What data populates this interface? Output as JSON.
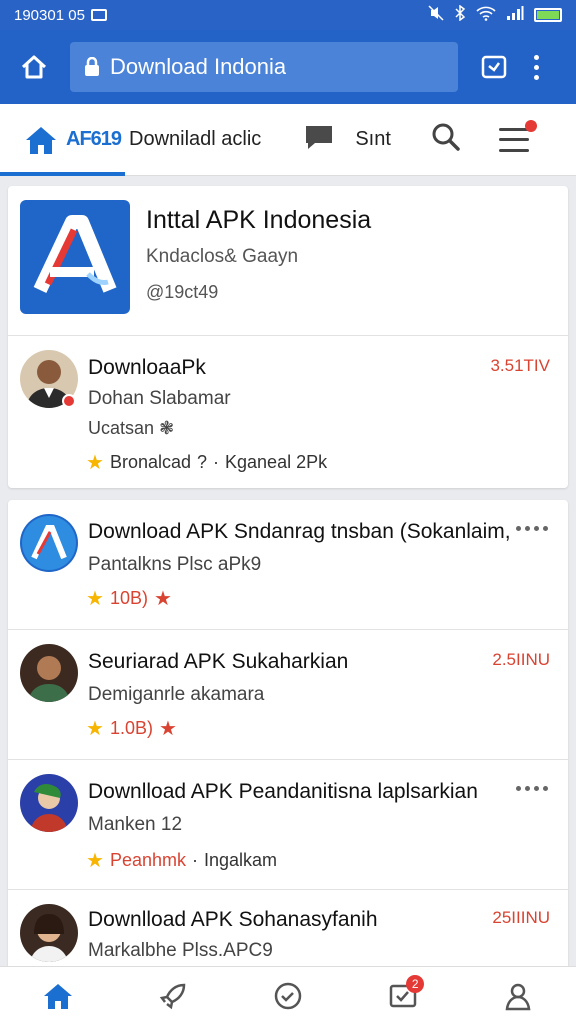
{
  "status_bar": {
    "time": "190301 05"
  },
  "browser": {
    "url_text": "Download Indonia"
  },
  "tabs": {
    "brand": "AF619",
    "download": "Downiladl aclic",
    "short": "Sınt"
  },
  "app": {
    "title": "Inttal APK Indonesia",
    "subtitle": "Kndaclos& Gaayn",
    "handle": "@19ct49"
  },
  "featured_review": {
    "name": "DownloaaPk",
    "line2": "Dohan Slabamar",
    "line3": "Ucatsan",
    "date": "3.51TIV",
    "meta_label": "Bronalcad",
    "meta_extra": "Kganeal 2Pk"
  },
  "list": [
    {
      "title": "Download APK Sndanrag tnsban (Sokanlaim,",
      "subtitle": "Pantalkns Plsc aPk9",
      "rating": "10B)",
      "date": ""
    },
    {
      "title": "Seuriarad APK Sukaharkian",
      "subtitle": "Demiganrle akamara",
      "rating": "1.0B)",
      "date": "2.5IINU"
    },
    {
      "title": "Downlload APK Peandanitisna laplsarkian",
      "subtitle": "Manken 12",
      "rating": "Peanhmk",
      "extra": "Ingalkam",
      "date": ""
    },
    {
      "title": "Downlload APK Sohanasyfanih",
      "subtitle": "Markalbhe Plss.APC9",
      "rating": "",
      "date": "25IIINU"
    }
  ],
  "bottom_nav": {
    "badge_count": "2"
  },
  "colors": {
    "primary": "#2363c8",
    "accent": "#1b6fd1",
    "date_red": "#d94432",
    "star": "#f7b500"
  }
}
